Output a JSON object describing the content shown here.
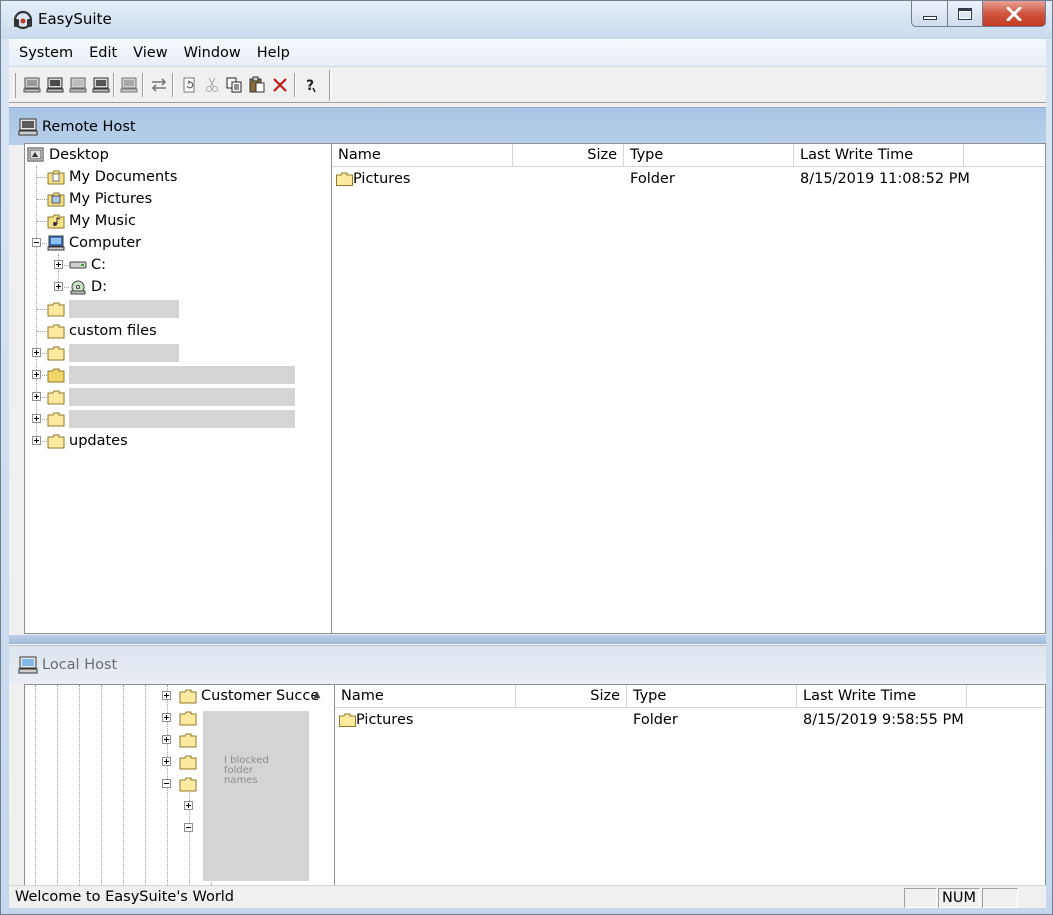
{
  "window": {
    "title": "EasySuite",
    "icon": "headset-icon"
  },
  "menubar": {
    "items": [
      "System",
      "Edit",
      "View",
      "Window",
      "Help"
    ]
  },
  "toolbar": {
    "buttons": [
      {
        "icon": "connect-icon"
      },
      {
        "icon": "disconnect-icon"
      },
      {
        "icon": "host-icon"
      },
      {
        "icon": "terminal-icon"
      },
      {
        "icon": "computer-icon"
      },
      {
        "icon": "transfer-icon"
      },
      {
        "icon": "refresh-icon"
      },
      {
        "icon": "cut-icon"
      },
      {
        "icon": "copy-icon"
      },
      {
        "icon": "paste-icon"
      },
      {
        "icon": "delete-icon"
      },
      {
        "icon": "help-icon"
      }
    ]
  },
  "remote": {
    "title": "Remote Host",
    "tree": {
      "desktop": "Desktop",
      "my_documents": "My Documents",
      "my_pictures": "My Pictures",
      "my_music": "My Music",
      "computer": "Computer",
      "drive_c": "C:",
      "drive_d": "D:",
      "custom_files": "custom files",
      "updates": "updates"
    },
    "columns": {
      "name": "Name",
      "size": "Size",
      "type": "Type",
      "time": "Last Write Time"
    },
    "rows": [
      {
        "name": "Pictures",
        "size": "",
        "type": "Folder",
        "time": "8/15/2019 11:08:52 PM"
      }
    ]
  },
  "local": {
    "title": "Local Host",
    "tree": {
      "customer": "Customer Succe",
      "blocked_note_1": "I blocked",
      "blocked_note_2": "folder",
      "blocked_note_3": "names"
    },
    "columns": {
      "name": "Name",
      "size": "Size",
      "type": "Type",
      "time": "Last Write Time"
    },
    "rows": [
      {
        "name": "Pictures",
        "size": "",
        "type": "Folder",
        "time": "8/15/2019 9:58:55 PM"
      }
    ]
  },
  "status": {
    "message": "Welcome to EasySuite's World",
    "num": "NUM",
    "cap": "",
    "scrl": ""
  },
  "colors": {
    "pane_header_active": "#a9c4e4",
    "folder_yellow": "#f5e08a",
    "close_red": "#c23a22"
  }
}
